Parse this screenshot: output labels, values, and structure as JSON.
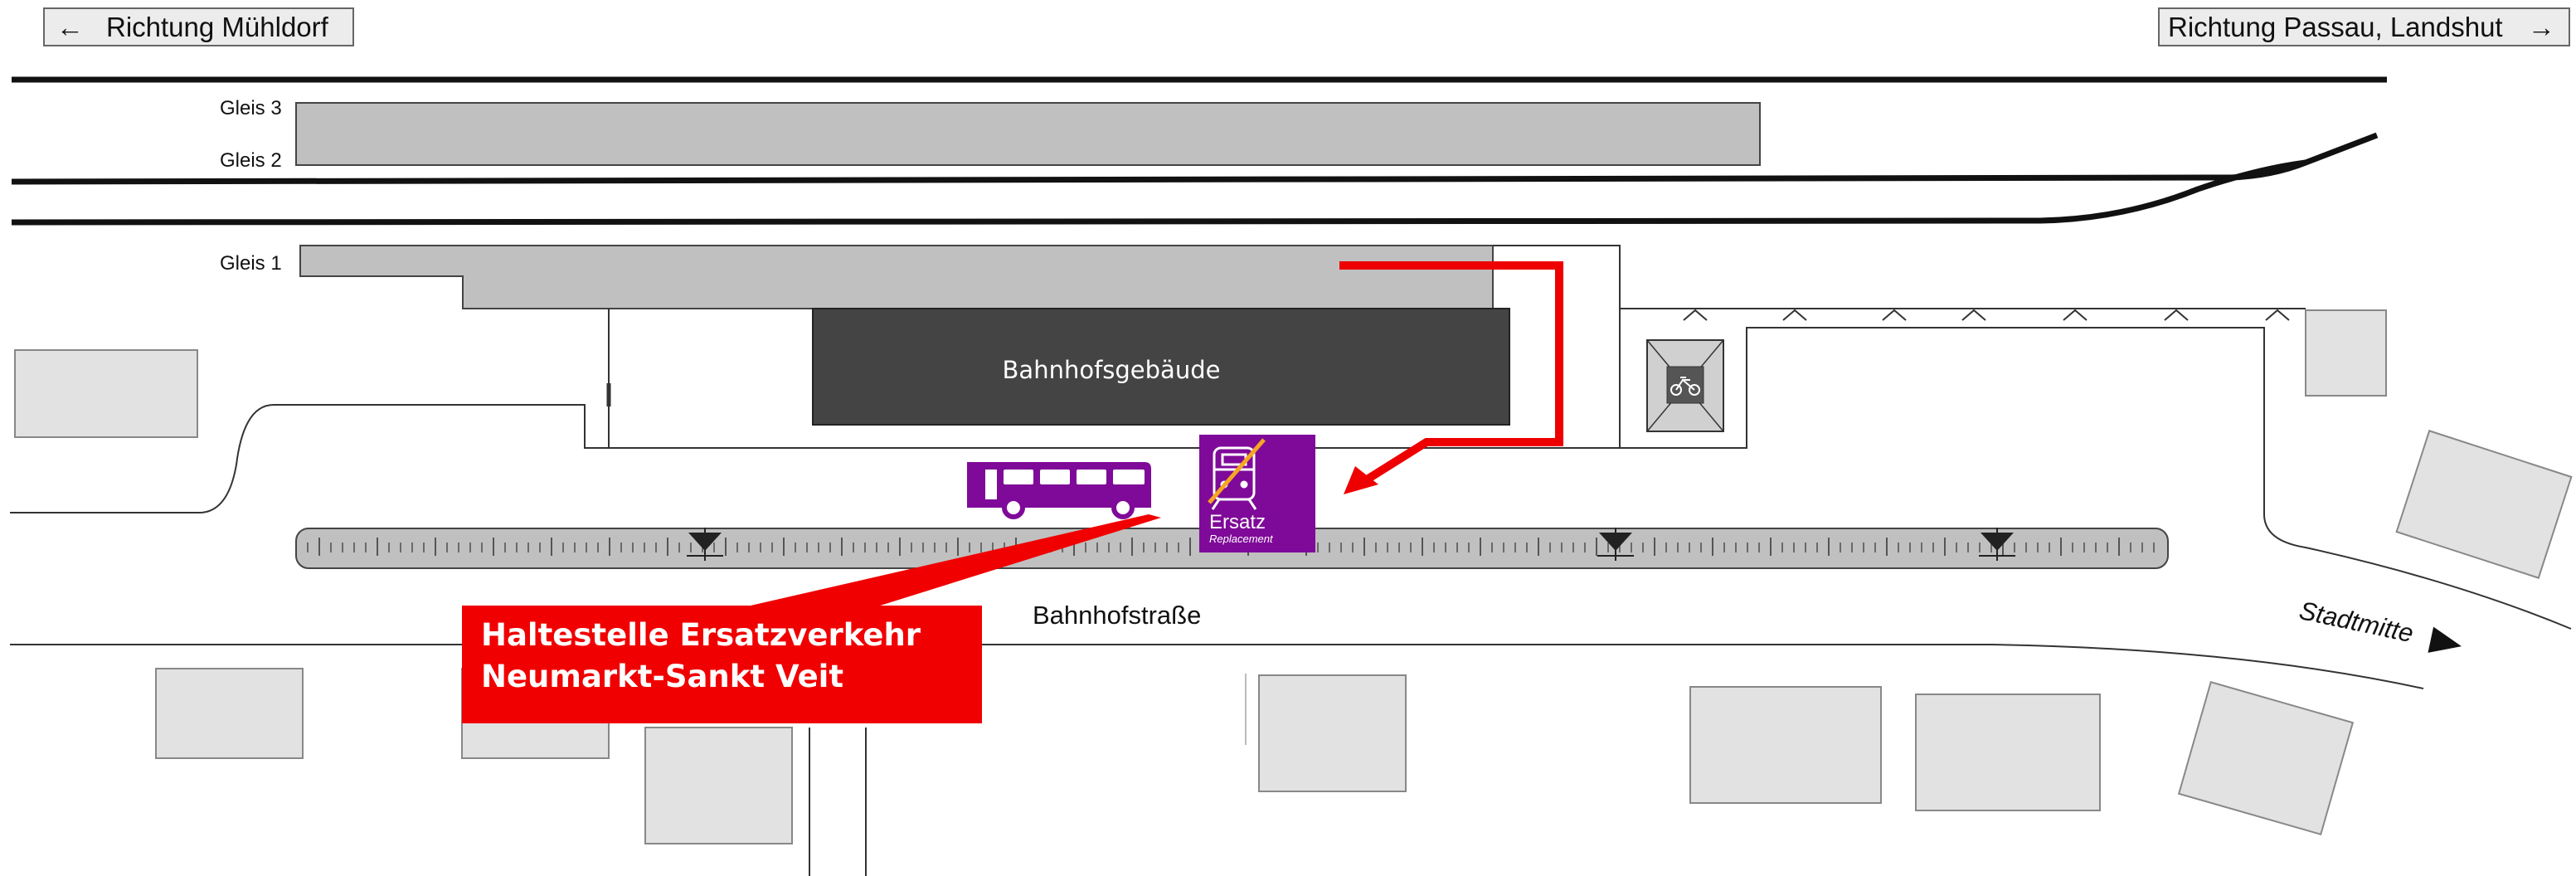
{
  "direction_signs": {
    "left": {
      "arrow": "←",
      "label": "Richtung Mühldorf"
    },
    "right": {
      "label": "Richtung Passau, Landshut",
      "arrow": "→"
    }
  },
  "tracks": {
    "gleis_3": "Gleis 3",
    "gleis_2": "Gleis 2",
    "gleis_1": "Gleis 1"
  },
  "station_building": {
    "label": "Bahnhofsgebäude"
  },
  "streets": {
    "main": "Bahnhofstraße",
    "city_center": "Stadtmitte"
  },
  "bus_stop": {
    "line1": "Haltestelle Ersatzverkehr",
    "line2": "Neumarkt-Sankt Veit",
    "background_color": "#f00000"
  },
  "ersatz_sign": {
    "label": "Ersatz",
    "sublabel": "Replacement",
    "background_color": "#7f0a99",
    "strike_color": "#f5a623"
  },
  "icons": {
    "bus": "bus-icon",
    "bicycle_parking": "bicycle-parking-icon",
    "replacement_train": "replacement-train-icon",
    "route_arrow": "route-arrow"
  },
  "colors": {
    "route": "#ee0000",
    "platform": "#c0c0c0",
    "building": "#444444",
    "bus": "#7f0a99",
    "neighbor_buildings": "#e2e2e2"
  }
}
